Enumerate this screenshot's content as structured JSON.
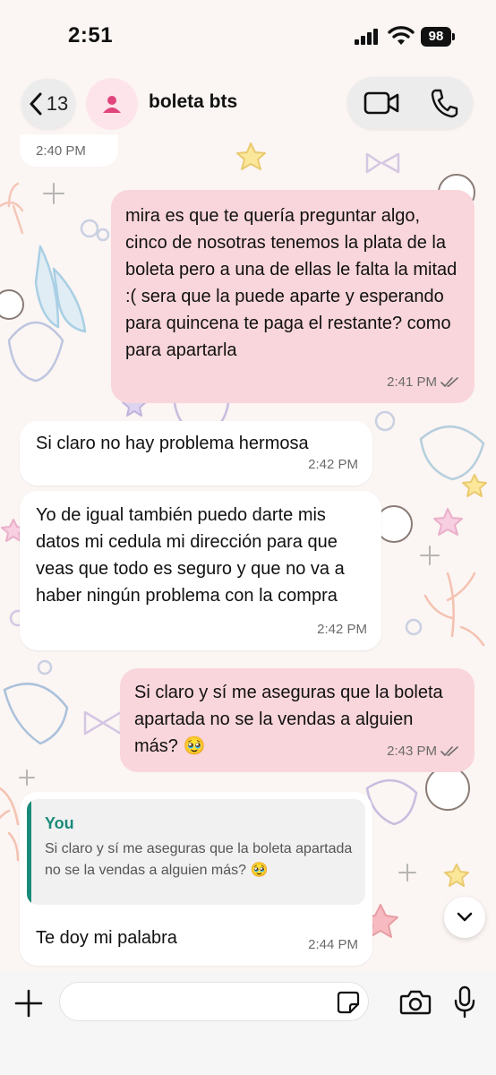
{
  "status_bar": {
    "time": "2:51",
    "battery": "98"
  },
  "header": {
    "back_count": "13",
    "title": "boleta bts"
  },
  "partial_timestamp": "2:40 PM",
  "messages": [
    {
      "direction": "outgoing",
      "text": "mira es que te quería preguntar algo, cinco de nosotras tenemos la plata de la boleta pero a una de ellas le falta la mitad :( sera que la puede aparte y esperando para quincena te paga el restante? como para apartarla",
      "time": "2:41 PM",
      "read": true
    },
    {
      "direction": "incoming",
      "text": "Si claro no hay problema hermosa",
      "time": "2:42 PM"
    },
    {
      "direction": "incoming",
      "text": "Yo de igual también puedo darte mis datos mi cedula mi dirección para que veas que todo es seguro y que no va a haber ningún problema con la compra",
      "time": "2:42 PM"
    },
    {
      "direction": "outgoing",
      "text": "Si claro y sí me aseguras que la boleta apartada no se la vendas a alguien más? 🥹",
      "time": "2:43 PM",
      "read": true
    },
    {
      "direction": "incoming",
      "reply_to": {
        "author": "You",
        "text": "Si claro y sí me aseguras que la boleta apartada no se la vendas a alguien más? 🥹"
      },
      "text": "Te doy mi palabra",
      "time": "2:44 PM"
    }
  ],
  "input": {
    "value": "",
    "placeholder": ""
  },
  "colors": {
    "outgoing_bubble": "#f9d6db",
    "incoming_bubble": "#ffffff",
    "reply_accent": "#1a8a7a",
    "wallpaper": "#fbf5f3"
  },
  "icons": [
    "back-chevron-icon",
    "contact-avatar-icon",
    "video-call-icon",
    "phone-call-icon",
    "read-receipt-icon",
    "chevron-down-icon",
    "plus-icon",
    "sticker-icon",
    "camera-icon",
    "microphone-icon"
  ]
}
